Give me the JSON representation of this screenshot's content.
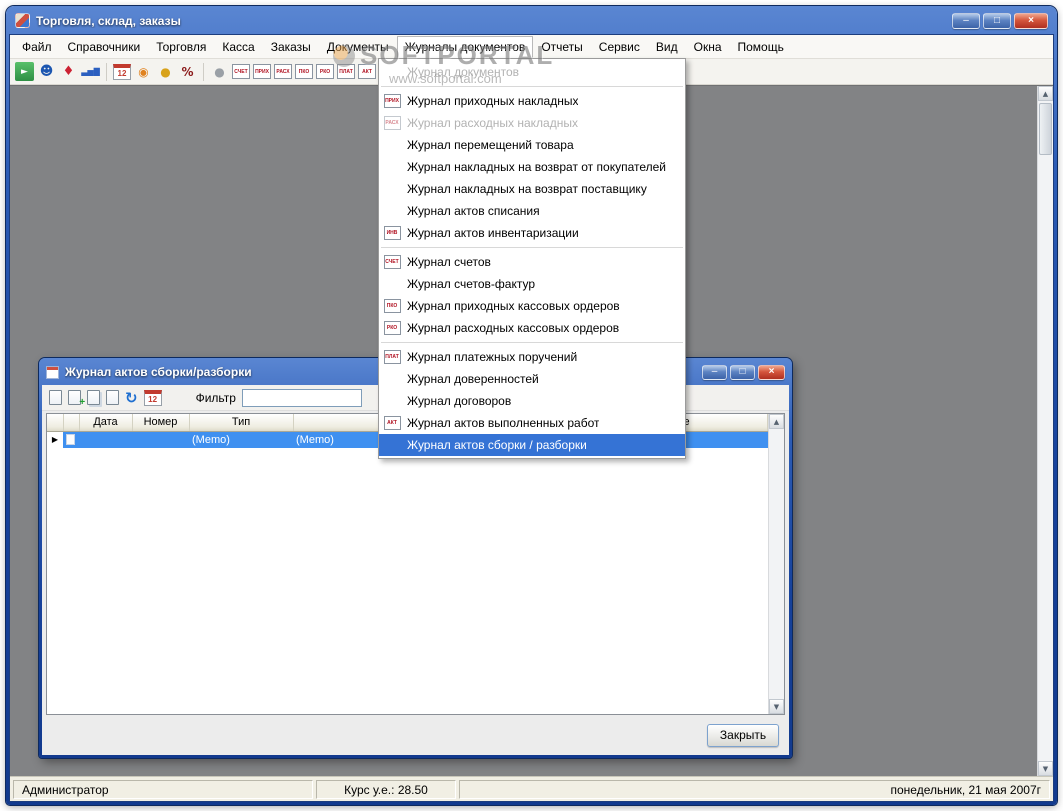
{
  "window": {
    "title": "Торговля, склад, заказы",
    "controls": {
      "minimize": "–",
      "maximize": "□",
      "close": "×"
    }
  },
  "watermark": {
    "line1": "SOFTPORTAL",
    "line2": "www.softportal.com"
  },
  "menubar": {
    "items": [
      "Файл",
      "Справочники",
      "Торговля",
      "Касса",
      "Заказы",
      "Документы",
      "Журналы документов",
      "Отчеты",
      "Сервис",
      "Вид",
      "Окна",
      "Помощь"
    ]
  },
  "toolbar": {
    "icons": [
      {
        "name": "exit-icon",
        "glyph": "►"
      },
      {
        "name": "contractors-icon",
        "glyph": "☻"
      },
      {
        "name": "goods-icon",
        "glyph": "♦"
      },
      {
        "name": "reports-icon",
        "glyph": "▃▅▇"
      },
      {
        "name": "calendar-icon",
        "glyph": "12"
      },
      {
        "name": "time-icon",
        "glyph": "◉"
      },
      {
        "name": "money-icon",
        "glyph": "●"
      },
      {
        "name": "rates-icon",
        "glyph": "%"
      },
      {
        "name": "services-icon",
        "glyph": "●"
      },
      {
        "name": "invoice-doc-icon",
        "glyph": "СЧЕТ"
      },
      {
        "name": "income-doc-icon",
        "glyph": "ПРИХ"
      },
      {
        "name": "expense-doc-icon",
        "glyph": "РАСХ"
      },
      {
        "name": "cash-in-doc-icon",
        "glyph": "ПКО"
      },
      {
        "name": "cash-out-doc-icon",
        "glyph": "РКО"
      },
      {
        "name": "payment-doc-icon",
        "glyph": "ПЛАТ"
      },
      {
        "name": "act-doc-icon",
        "glyph": "АКТ"
      },
      {
        "name": "internet-icon",
        "glyph": "⊕"
      },
      {
        "name": "coin-icon",
        "glyph": "◉"
      }
    ]
  },
  "dropdown": {
    "items": [
      {
        "label": "Журнал документов"
      },
      {
        "separator": true
      },
      {
        "label": "Журнал приходных накладных",
        "icon": "ПРИХ"
      },
      {
        "label": "Журнал расходных накладных",
        "icon": "РАСХ"
      },
      {
        "label": "Журнал перемещений товара"
      },
      {
        "label": "Журнал накладных на возврат от покупателей"
      },
      {
        "label": "Журнал накладных на возврат поставщику"
      },
      {
        "label": "Журнал актов списания"
      },
      {
        "label": "Журнал актов инвентаризации",
        "icon": "ИНВ"
      },
      {
        "separator": true
      },
      {
        "label": "Журнал счетов",
        "icon": "СЧЕТ"
      },
      {
        "label": "Журнал счетов-фактур"
      },
      {
        "label": "Журнал приходных кассовых ордеров",
        "icon": "ПКО"
      },
      {
        "label": "Журнал расходных кассовых ордеров",
        "icon": "РКО"
      },
      {
        "separator": true
      },
      {
        "label": "Журнал платежных поручений",
        "icon": "ПЛАТ"
      },
      {
        "label": "Журнал доверенностей"
      },
      {
        "label": "Журнал договоров"
      },
      {
        "label": "Журнал актов выполненных работ",
        "icon": "АКТ"
      },
      {
        "label": "Журнал актов сборки / разборки"
      }
    ]
  },
  "scroll": {
    "up": "▲",
    "down": "▼"
  },
  "child_window": {
    "title": "Журнал актов сборки/разборки",
    "controls": {
      "minimize": "–",
      "maximize": "□",
      "close": "×"
    },
    "toolbar": {
      "filter_label": "Фильтр",
      "filter_value": "",
      "add_badge": "+",
      "refresh_glyph": "↻",
      "calendar_glyph": "12"
    },
    "table": {
      "marker": "▶",
      "columns": [
        "",
        "",
        "Дата",
        "Номер",
        "Тип",
        "",
        "",
        "Примечание"
      ],
      "row": [
        "",
        "",
        "",
        "",
        "(Memo)",
        "(Memo)",
        "",
        ""
      ]
    },
    "close_button": "Закрыть"
  },
  "statusbar": {
    "user": "Администратор",
    "rate": "Курс у.е.: 28.50",
    "date": "понедельник, 21 мая 2007г"
  }
}
